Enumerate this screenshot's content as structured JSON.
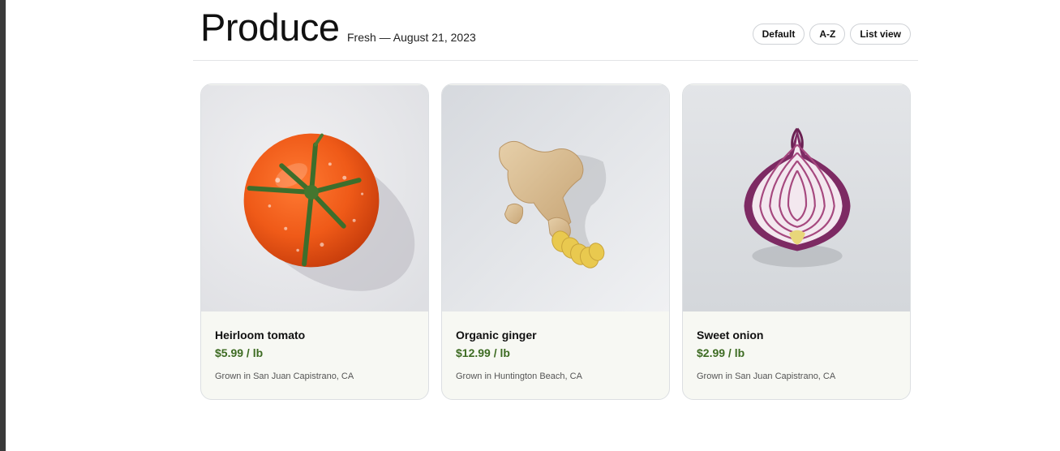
{
  "header": {
    "title": "Produce",
    "subtitle": "Fresh — August 21, 2023",
    "controls": [
      {
        "label": "Default"
      },
      {
        "label": "A-Z"
      },
      {
        "label": "List view"
      }
    ]
  },
  "products": [
    {
      "name": "Heirloom tomato",
      "price": "$5.99 / lb",
      "origin": "Grown in San Juan Capistrano, CA",
      "image": "tomato-photo"
    },
    {
      "name": "Organic ginger",
      "price": "$12.99 / lb",
      "origin": "Grown in Huntington Beach, CA",
      "image": "ginger-photo"
    },
    {
      "name": "Sweet onion",
      "price": "$2.99 / lb",
      "origin": "Grown in San Juan Capistrano, CA",
      "image": "onion-photo"
    }
  ]
}
